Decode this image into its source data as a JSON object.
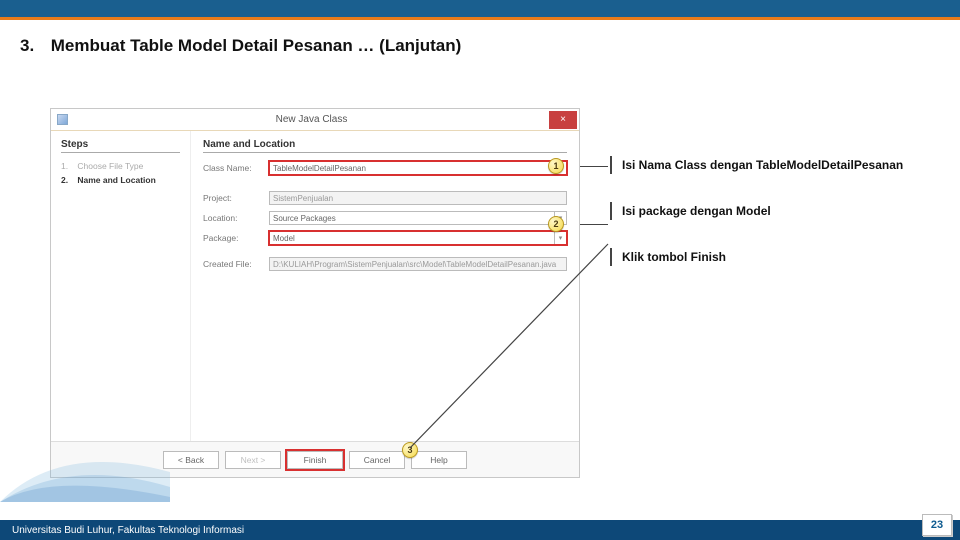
{
  "slide": {
    "number": "3.",
    "title": "Membuat Table Model Detail Pesanan … (Lanjutan)"
  },
  "dialog": {
    "title": "New Java Class",
    "steps_header": "Steps",
    "steps": [
      {
        "n": "1.",
        "label": "Choose File Type"
      },
      {
        "n": "2.",
        "label": "Name and Location"
      }
    ],
    "form_header": "Name and Location",
    "fields": {
      "class_name_label": "Class Name:",
      "class_name_value": "TableModelDetailPesanan",
      "project_label": "Project:",
      "project_value": "SistemPenjualan",
      "location_label": "Location:",
      "location_value": "Source Packages",
      "package_label": "Package:",
      "package_value": "Model",
      "created_label": "Created File:",
      "created_value": "D:\\KULIAH\\Program\\SistemPenjualan\\src\\Model\\TableModelDetailPesanan.java"
    },
    "buttons": {
      "back": "< Back",
      "next": "Next >",
      "finish": "Finish",
      "cancel": "Cancel",
      "help": "Help"
    }
  },
  "bubbles": {
    "b1": "1",
    "b2": "2",
    "b3": "3"
  },
  "callouts": {
    "c1": "Isi Nama Class dengan TableModelDetailPesanan",
    "c2": "Isi package dengan Model",
    "c3": "Klik tombol Finish"
  },
  "footer": {
    "text": "Universitas Budi Luhur, Fakultas Teknologi Informasi",
    "page": "23"
  }
}
